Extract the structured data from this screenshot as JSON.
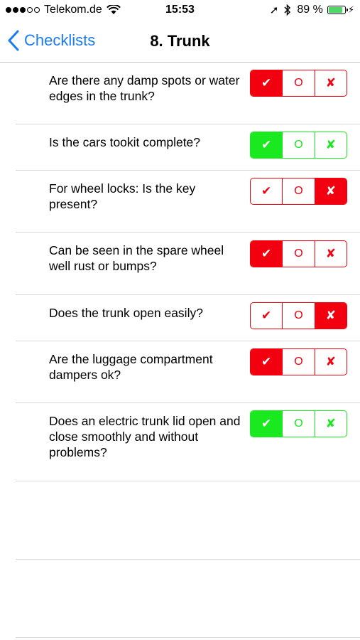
{
  "status_bar": {
    "carrier": "Telekom.de",
    "time": "15:53",
    "battery_percent": "89 %",
    "battery_level": 0.89,
    "battery_color": "#4cd964"
  },
  "nav": {
    "back_label": "Checklists",
    "title": "8. Trunk",
    "accent_color": "#1a7cf5"
  },
  "options": {
    "yes_symbol": "✔",
    "neutral_symbol": "O",
    "no_symbol": "✘"
  },
  "colors": {
    "negative": "#f2000f",
    "positive": "#19e91e"
  },
  "questions": [
    {
      "text": "Are there any damp spots or water edges in the trunk?",
      "selected": "yes",
      "tone": "red"
    },
    {
      "text": "Is the cars tookit complete?",
      "selected": "yes",
      "tone": "green"
    },
    {
      "text": "For wheel locks: Is the key present?",
      "selected": "no",
      "tone": "red"
    },
    {
      "text": "Can be seen in the spare wheel well rust or bumps?",
      "selected": "yes",
      "tone": "red"
    },
    {
      "text": "Does the trunk open easily?",
      "selected": "no",
      "tone": "red"
    },
    {
      "text": "Are the luggage compartment dampers ok?",
      "selected": "yes",
      "tone": "red"
    },
    {
      "text": "Does an electric trunk lid open and close smoothly and without problems?",
      "selected": "yes",
      "tone": "green"
    }
  ]
}
